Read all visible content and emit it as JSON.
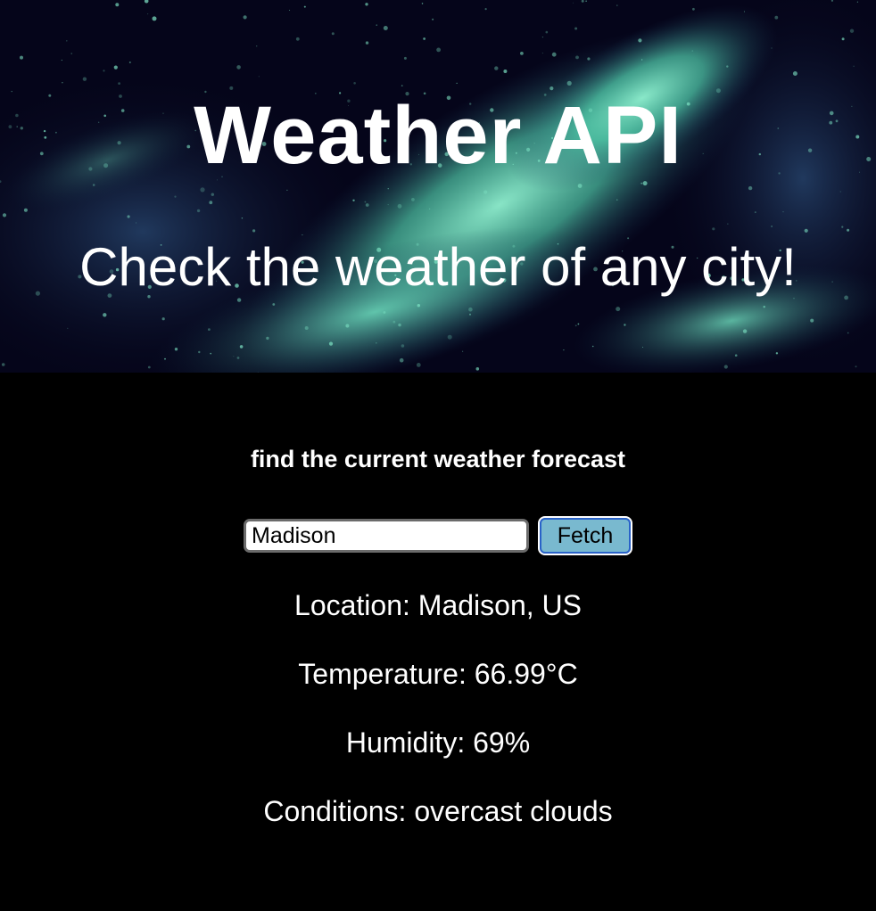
{
  "header": {
    "title": "Weather API",
    "subtitle": "Check the weather of any city!"
  },
  "main": {
    "prompt": "find the current weather forecast",
    "search": {
      "value": "Madison",
      "placeholder": ""
    },
    "fetch_label": "Fetch",
    "results": {
      "location": "Location: Madison, US",
      "temperature": "Temperature: 66.99°C",
      "humidity": "Humidity: 69%",
      "conditions": "Conditions: overcast clouds"
    }
  },
  "colors": {
    "page_background": "#000000",
    "hero_background": "#05051a",
    "nebula": "#5fd9b8",
    "button_fill": "#79b9cf",
    "button_focus_ring": "#2a62c8",
    "text": "#ffffff"
  }
}
